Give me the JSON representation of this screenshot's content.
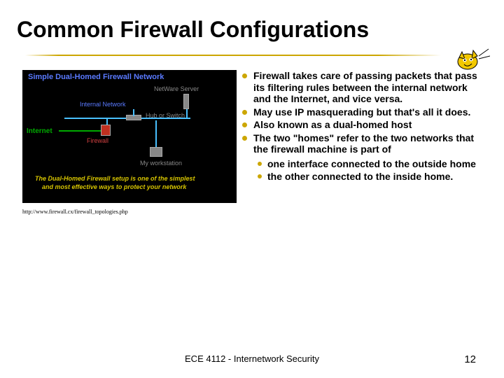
{
  "title": "Common Firewall Configurations",
  "diagram": {
    "heading": "Simple Dual-Homed Firewall Network",
    "netware": "NetWare Server",
    "internal": "Internal Network",
    "hub": "Hub or Switch",
    "internet": "Internet",
    "firewall": "Firewall",
    "workstation": "My workstation",
    "caption1": "The Dual-Homed Firewall setup is one of the simplest",
    "caption2": "and most effective ways to protect your network"
  },
  "citation": "http://www.firewall.cx/firewall_topologies.php",
  "bullets": [
    "Firewall takes care of passing packets that pass its filtering rules between the internal network and the Internet, and vice versa.",
    "May use IP masquerading but that's all it does.",
    "Also known as a dual-homed host",
    "The two \"homes\" refer to the two networks that the firewall machine is part of"
  ],
  "sub_bullets": [
    "one interface connected to the outside home",
    "the other connected to the inside home."
  ],
  "footer": "ECE 4112 - Internetwork Security",
  "page_number": "12"
}
